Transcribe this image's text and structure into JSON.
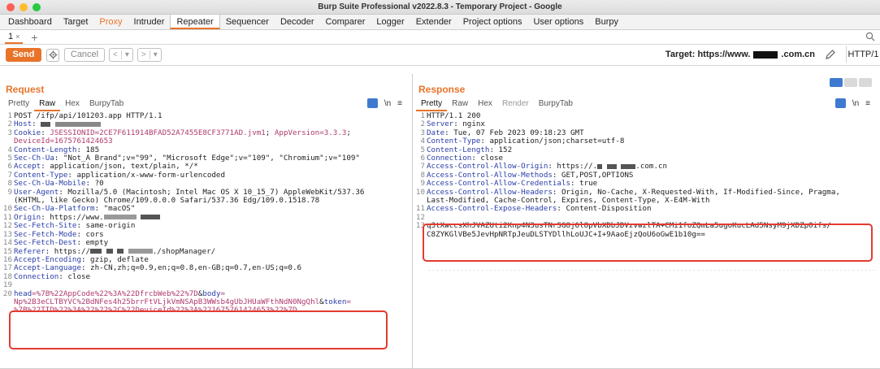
{
  "window": {
    "title": "Burp Suite Professional v2022.8.3 - Temporary Project - Google",
    "colors": {
      "close": "#ff5f57",
      "minimize": "#febc2e",
      "maximize": "#28c840",
      "accent": "#e8742a"
    }
  },
  "main_tabs": [
    "Dashboard",
    "Target",
    "Proxy",
    "Intruder",
    "Repeater",
    "Sequencer",
    "Decoder",
    "Comparer",
    "Logger",
    "Extender",
    "Project options",
    "User options",
    "Burpy"
  ],
  "repeater": {
    "tab_label": "1",
    "tab_close": "×",
    "add_tab": "+"
  },
  "toolbar": {
    "send_label": "Send",
    "cancel_label": "Cancel",
    "prev": "<",
    "prev_menu": "▾",
    "next": ">",
    "next_menu": "▾",
    "target_prefix": "Target: https://www.",
    "target_suffix": ".com.cn",
    "http_version": "HTTP/1"
  },
  "request": {
    "title": "Request",
    "view_tabs": [
      "Pretty",
      "Raw",
      "Hex",
      "BurpyTab"
    ],
    "active_view": "Raw",
    "newline_toggle": "\\n",
    "menu_icon": "≡",
    "lines": {
      "l1": "POST /ifp/api/101203.app HTTP/1.1",
      "l2k": "Host",
      "l2v": ": ",
      "l3k": "Cookie",
      "l3a": ": ",
      "l3b": "JSESSIONID=2CE7F611914BFAD52A7455E8CF3771AD.jvm1",
      "l3c": "; ",
      "l3d": "AppVersion=3.3.3",
      "l3e": ";",
      "l4": "DeviceId=1675761424653",
      "l5k": "Content-Length",
      "l5v": ": 185",
      "l6k": "Sec-Ch-Ua",
      "l6v": ": \"Not_A Brand\";v=\"99\", \"Microsoft Edge\";v=\"109\", \"Chromium\";v=\"109\"",
      "l7k": "Accept",
      "l7v": ": application/json, text/plain, */*",
      "l8k": "Content-Type",
      "l8v": ": application/x-www-form-urlencoded",
      "l9k": "Sec-Ch-Ua-Mobile",
      "l9v": ": ?0",
      "l10k": "User-Agent",
      "l10v": ": Mozilla/5.0 (Macintosh; Intel Mac OS X 10_15_7) AppleWebKit/537.36",
      "l10w": "(KHTML, like Gecko) Chrome/109.0.0.0 Safari/537.36 Edg/109.0.1518.78",
      "l11k": "Sec-Ch-Ua-Platform",
      "l11v": ": \"macOS\"",
      "l12k": "Origin",
      "l12v": ": https://www.",
      "l13k": "Sec-Fetch-Site",
      "l13v": ": same-origin",
      "l14k": "Sec-Fetch-Mode",
      "l14v": ": cors",
      "l15k": "Sec-Fetch-Dest",
      "l15v": ": empty",
      "l16k": "Referer",
      "l16v": ": https://",
      "l16w": "./shopManager/",
      "l17k": "Accept-Encoding",
      "l17v": ": gzip, deflate",
      "l18k": "Accept-Language",
      "l18v": ": zh-CN,zh;q=0.9,en;q=0.8,en-GB;q=0.7,en-US;q=0.6",
      "l19k": "Connection",
      "l19v": ": close",
      "b1k": "head",
      "b1v": "=%7B%22AppCode%22%3A%22DfrcbWeb%22%7D",
      "b1a": "&",
      "b1k2": "body",
      "b1v2": "=",
      "b2v": "Np%2B3eCLTBYVC%2BdNFes4h25brrFtVLjkVmNSApB3WWsb4gUbJHUaWFthNdN0NgQhl",
      "b2a": "&",
      "b2k": "token",
      "b2v2": "=",
      "b3v": "%7B%22TID%22%3A%22%22%2C%22DeviceId%22%3A%221675761424653%22%7D"
    }
  },
  "response": {
    "title": "Response",
    "view_tabs": [
      "Pretty",
      "Raw",
      "Hex",
      "Render",
      "BurpyTab"
    ],
    "active_view": "Pretty",
    "newline_toggle": "\\n",
    "menu_icon": "≡",
    "lines": {
      "l1": "HTTP/1.1 200",
      "l2k": "Server",
      "l2v": ": nginx",
      "l3k": "Date",
      "l3v": ": Tue, 07 Feb 2023 09:18:23 GMT",
      "l4k": "Content-Type",
      "l4v": ": application/json;charset=utf-8",
      "l5k": "Content-Length",
      "l5v": ": 152",
      "l6k": "Connection",
      "l6v": ": close",
      "l7k": "Access-Control-Allow-Origin",
      "l7v": ": https://.",
      "l7w": ".com.cn",
      "l8k": "Access-Control-Allow-Methods",
      "l8v": ": GET,POST,OPTIONS",
      "l9k": "Access-Control-Allow-Credentials",
      "l9v": ": true",
      "l10k": "Access-Control-Allow-Headers",
      "l10v": ": Origin, No-Cache, X-Requested-With, If-Modified-Since, Pragma,",
      "l10w": "Last-Modified, Cache-Control, Expires, Content-Type, X-E4M-With",
      "l11k": "Access-Control-Expose-Headers",
      "l11v": ": Content-Disposition",
      "b1": "q3tXwccsXhJVAZUti2Knp4N3usTNrSG8j6l8pVbXDbJDVzvwzlTA+CMi1foZQmLa5ugoKucLAd5NsyM9jXDZp0ifs/",
      "b2": "C8ZYKGlVBe5JevHpNRTpJeuDLSTYDllhLoUJC+I+9AaoEjzQoU6oGwE1b10g=="
    }
  }
}
